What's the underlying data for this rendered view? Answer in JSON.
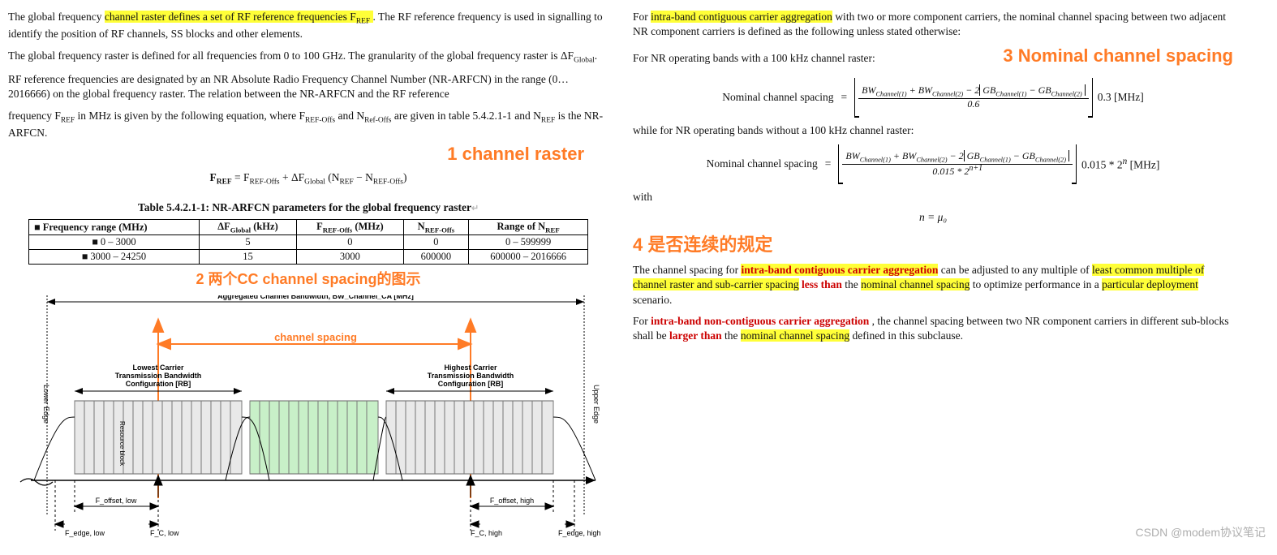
{
  "left": {
    "para1_pre": "The global frequency ",
    "para1_hl": "channel raster defines a set of RF reference frequencies F",
    "para1_hl_sub": "REF",
    "para1_rest": ". The RF reference frequency is used in signalling to identify the position of RF channels, SS blocks and other elements.",
    "para2": "The global frequency raster is defined for all frequencies from 0 to 100 GHz. The granularity of the global frequency raster is ΔF",
    "para2_sub": "Global",
    "para3": "RF reference frequencies are designated by an NR Absolute Radio Frequency Channel Number (NR-ARFCN) in the range (0…2016666) on the global frequency raster. The relation between the NR-ARFCN and the RF reference",
    "para4_a": "frequency F",
    "para4_a_sub": "REF",
    "para4_b": " in MHz is given by the following equation, where F",
    "para4_b_sub": "REF-Offs",
    "para4_c": " and N",
    "para4_c_sub": "Ref-Offs",
    "para4_d": " are given in table 5.4.2.1-1 and N",
    "para4_d_sub": "REF",
    "para4_e": " is the NR-ARFCN.",
    "annot1": "1 channel raster",
    "eq1": "F_REF = F_REF-Offs + ΔF_Global (N_REF − N_REF-Offs)",
    "table_title": "Table 5.4.2.1-1: NR-ARFCN parameters for the global frequency raster",
    "table_headers": [
      "Frequency range (MHz)",
      "ΔF_Global (kHz)",
      "F_REF-Offs (MHz)",
      "N_REF-Offs",
      "Range of N_REF"
    ],
    "table_rows": [
      [
        "0 – 3000",
        "5",
        "0",
        "0",
        "0 – 599999"
      ],
      [
        "3000 – 24250",
        "15",
        "3000",
        "600000",
        "600000 – 2016666"
      ]
    ],
    "annot2_pre": "2 两个CC ",
    "annot2_mid": "channel spacing",
    "annot2_post": "的图示",
    "diagram": {
      "agg_bw_label": "Aggregated Channel Bandwidth, BW_Channel_CA [MHz]",
      "channel_spacing_label": "channel spacing",
      "lower_edge": "Lower Edge",
      "upper_edge": "Upper Edge",
      "rb_label": "Resource block",
      "low_cfg1": "Lowest Carrier",
      "low_cfg2": "Transmission Bandwidth",
      "low_cfg3": "Configuration [RB]",
      "high_cfg1": "Highest Carrier",
      "high_cfg2": "Transmission Bandwidth",
      "high_cfg3": "Configuration [RB]",
      "f_offset_low": "F_offset, low",
      "f_offset_high": "F_offset, high",
      "f_edge_low": "F_edge, low",
      "f_edge_high": "F_edge, high",
      "f_c_low": "F_C, low",
      "f_c_high": "F_C, high"
    }
  },
  "right": {
    "para1_pre": "For ",
    "para1_hl": "intra-band contiguous carrier aggregation",
    "para1_rest": " with two or more component carriers, the nominal channel spacing between two adjacent NR component carriers is defined as the following unless stated otherwise:",
    "para2": "For NR operating bands with a 100 kHz channel raster:",
    "annot3": "3 Nominal channel spacing",
    "formula1": {
      "label": "Nominal  channel  spacing",
      "num_a": "BW",
      "num_b": "BW",
      "num_c": "GB",
      "num_d": "GB",
      "sub1": "Channel(1)",
      "sub2": "Channel(2)",
      "sub3": "Channel(1)",
      "sub4": "Channel(2)",
      "den": "0.6",
      "tail": "0.3 [MHz]"
    },
    "para3": "while for NR operating bands without a 100 kHz channel raster:",
    "formula2": {
      "label": "Nominal  channel  spacing",
      "den": "0.015 * 2",
      "den_sup": "n+1",
      "tail_a": "0.015 * 2",
      "tail_sup": "n",
      "tail_b": " [MHz]"
    },
    "with_label": "with",
    "n_eq": "n = μ₀",
    "annot4": "4 是否连续的规定",
    "para4_a": "The channel spacing for ",
    "para4_red1": "intra-band contiguous carrier aggregation",
    "para4_b": " can be adjusted to any multiple of ",
    "para4_hl1": "least common multiple of channel raster and sub-carrier spacing",
    "para4_red2": " less than",
    "para4_c": " the ",
    "para4_hl2": "nominal channel spacing",
    "para4_d": " to optimize performance in a ",
    "para4_hl3": "particular deployment",
    "para4_e": " scenario.",
    "para5_a": "For ",
    "para5_red1": "intra-band non-contiguous carrier aggregation",
    "para5_b": ", the channel spacing between two NR component carriers in different sub-blocks shall be ",
    "para5_red2": "larger than",
    "para5_c": " the ",
    "para5_hl1": "nominal channel spacing",
    "para5_d": " defined in this subclause."
  },
  "watermark": "CSDN @modem协议笔记"
}
